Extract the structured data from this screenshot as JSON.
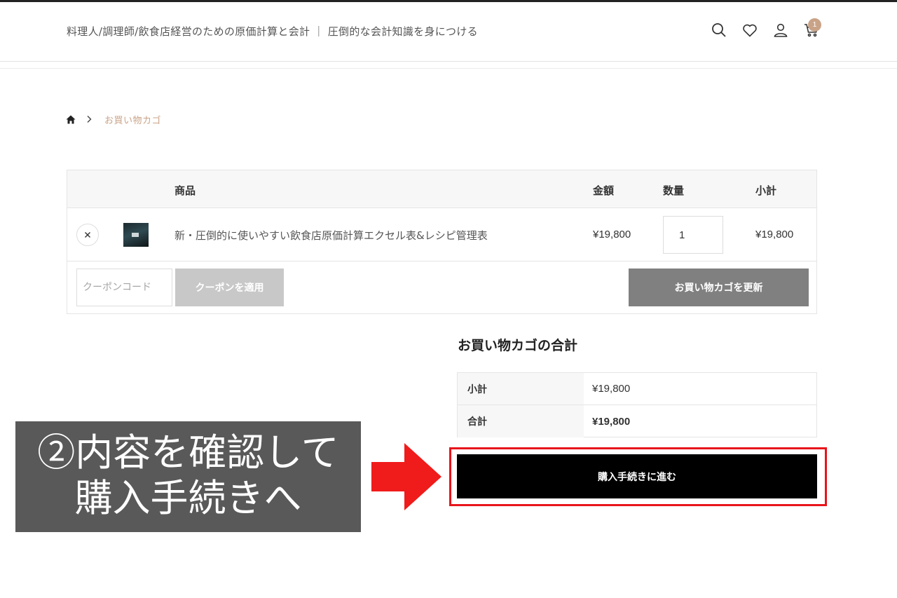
{
  "header": {
    "site_title": "料理人/調理師/飲食店経営のための原価計算と会計 ｜ 圧倒的な会計知識を身につける",
    "icons": [
      "search-icon",
      "heart-icon",
      "user-icon",
      "cart-icon"
    ],
    "cart_count": "1",
    "badge_color": "#c9a387"
  },
  "breadcrumb": {
    "home_icon": "home-icon",
    "current": "お買い物カゴ"
  },
  "cart": {
    "columns": [
      "",
      "",
      "商品",
      "金額",
      "数量",
      "小計"
    ],
    "items": [
      {
        "remove_icon": "close-icon",
        "name": "新・圧倒的に使いやすい飲食店原価計算エクセル表&レシピ管理表",
        "price": "¥19,800",
        "quantity": "1",
        "subtotal": "¥19,800"
      }
    ],
    "coupon_placeholder": "クーポンコード",
    "apply_coupon_label": "クーポンを適用",
    "update_cart_label": "お買い物カゴを更新"
  },
  "totals": {
    "title": "お買い物カゴの合計",
    "rows": [
      {
        "label": "小計",
        "value": "¥19,800"
      },
      {
        "label": "合計",
        "value": "¥19,800"
      }
    ],
    "checkout_label": "購入手続きに進む"
  },
  "annotation": {
    "line1": "②内容を確認して",
    "line2": "購入手続きへ",
    "box_color": "#595959",
    "highlight_color": "#e8141b"
  }
}
